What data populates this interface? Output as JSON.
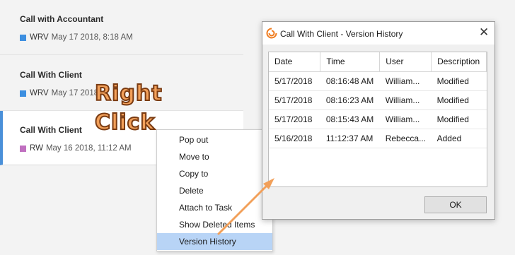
{
  "items": [
    {
      "title": "Call with Accountant",
      "initials": "WRV",
      "date": "May 17 2018, 8:18 AM",
      "color": "#3d8fe0"
    },
    {
      "title": "Call With Client",
      "initials": "WRV",
      "date": "May 17 2018,",
      "color": "#3d8fe0"
    },
    {
      "title": "Call With Client",
      "initials": "RW",
      "date": "May 16 2018, 11:12 AM",
      "color": "#c070c0"
    }
  ],
  "overlay": {
    "line1": "Right",
    "line2": "Click"
  },
  "context_menu": {
    "items": [
      "Pop out",
      "Move to",
      "Copy to",
      "Delete",
      "Attach to Task",
      "Show Deleted Items",
      "Version History"
    ],
    "highlighted": "Version History"
  },
  "dialog": {
    "icon": "sync-logo-icon",
    "title": "Call With Client - Version History",
    "columns": [
      "Date",
      "Time",
      "User",
      "Description"
    ],
    "rows": [
      [
        "5/17/2018",
        "08:16:48 AM",
        "William...",
        "Modified"
      ],
      [
        "5/17/2018",
        "08:16:23 AM",
        "William...",
        "Modified"
      ],
      [
        "5/17/2018",
        "08:15:43 AM",
        "William...",
        "Modified"
      ],
      [
        "5/16/2018",
        "11:12:37 AM",
        "Rebecca...",
        "Added"
      ]
    ],
    "ok_label": "OK"
  },
  "colors": {
    "accent": "#4a90d9",
    "highlight": "#b8d4f6",
    "annotation": "#f2a05a"
  }
}
